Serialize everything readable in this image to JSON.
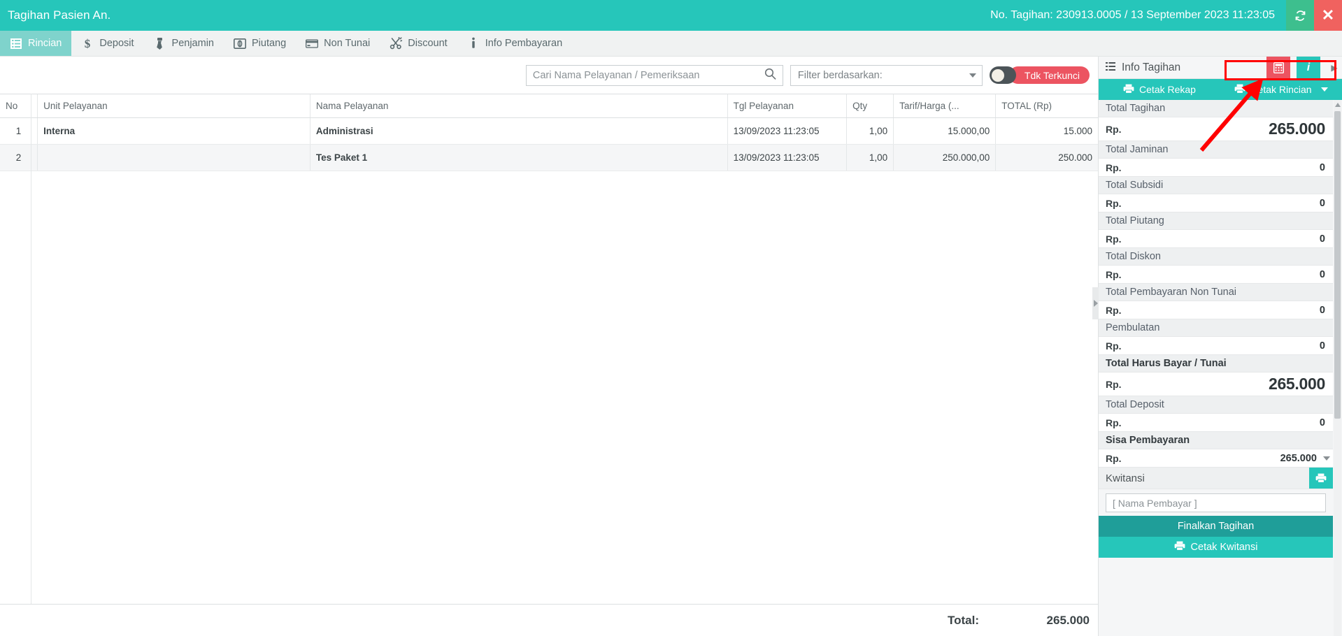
{
  "window": {
    "title": "Tagihan Pasien An.",
    "bill_info": "No. Tagihan: 230913.0005 / 13 September 2023 11:23:05",
    "refresh_icon": "refresh-icon",
    "close_icon": "close-icon",
    "accent_teal": "#26c6ba",
    "accent_red": "#ec5461",
    "annotation_color": "#ff0000"
  },
  "tabs": [
    {
      "label": "Rincian",
      "icon": "list-icon",
      "active": true
    },
    {
      "label": "Deposit",
      "icon": "dollar-icon",
      "active": false
    },
    {
      "label": "Penjamin",
      "icon": "tie-icon",
      "active": false
    },
    {
      "label": "Piutang",
      "icon": "coin-icon",
      "active": false
    },
    {
      "label": "Non Tunai",
      "icon": "card-icon",
      "active": false
    },
    {
      "label": "Discount",
      "icon": "scissors-icon",
      "active": false
    },
    {
      "label": "Info Pembayaran",
      "icon": "info-icon",
      "active": false
    }
  ],
  "toolbar": {
    "search_placeholder": "Cari Nama Pelayanan / Pemeriksaan",
    "search_value": "",
    "search_icon": "search-icon",
    "filter_label": "Filter berdasarkan:",
    "lock_label": "Tdk Terkunci",
    "lock_state": "off"
  },
  "table": {
    "columns": [
      "No",
      "Unit Pelayanan",
      "Nama Pelayanan",
      "Tgl Pelayanan",
      "Qty",
      "Tarif/Harga (...",
      "TOTAL (Rp)"
    ],
    "rows": [
      {
        "no": "1",
        "unit": "Interna",
        "nama": "Administrasi",
        "tgl": "13/09/2023 11:23:05",
        "qty": "1,00",
        "tarif": "15.000,00",
        "total": "15.000"
      },
      {
        "no": "2",
        "unit": "",
        "nama": "Tes Paket 1",
        "tgl": "13/09/2023 11:23:05",
        "qty": "1,00",
        "tarif": "250.000,00",
        "total": "250.000"
      }
    ],
    "footer_label": "Total:",
    "footer_value": "265.000"
  },
  "info_panel": {
    "header_title": "Info Tagihan",
    "header_list_icon": "list-icon",
    "calc_icon": "calculator-icon",
    "info_icon": "info-icon",
    "next_icon": "chevron-right-icon",
    "print_rekap_label": "Cetak Rekap",
    "print_rincian_label": "Cetak Rincian",
    "print_icon": "printer-icon",
    "currency": "Rp.",
    "entries": [
      {
        "label": "Total Tagihan",
        "value": "265.000",
        "bold_label": false,
        "big_value": true
      },
      {
        "label": "Total Jaminan",
        "value": "0",
        "bold_label": false,
        "big_value": false
      },
      {
        "label": "Total Subsidi",
        "value": "0",
        "bold_label": false,
        "big_value": false
      },
      {
        "label": "Total Piutang",
        "value": "0",
        "bold_label": false,
        "big_value": false
      },
      {
        "label": "Total Diskon",
        "value": "0",
        "bold_label": false,
        "big_value": false
      },
      {
        "label": "Total Pembayaran Non Tunai",
        "value": "0",
        "bold_label": false,
        "big_value": false
      },
      {
        "label": "Pembulatan",
        "value": "0",
        "bold_label": false,
        "big_value": false
      },
      {
        "label": "Total Harus Bayar / Tunai",
        "value": "265.000",
        "bold_label": true,
        "big_value": true
      },
      {
        "label": "Total Deposit",
        "value": "0",
        "bold_label": false,
        "big_value": false
      },
      {
        "label": "Sisa Pembayaran",
        "value": "265.000",
        "bold_label": true,
        "big_value": false,
        "caret": true
      }
    ],
    "kwitansi_label": "Kwitansi",
    "kwitansi_print_icon": "printer-icon",
    "payer_placeholder": "[ Nama Pembayar ]",
    "payer_value": "",
    "finalize_label": "Finalkan Tagihan",
    "print_kwitansi_label": "Cetak Kwitansi"
  }
}
